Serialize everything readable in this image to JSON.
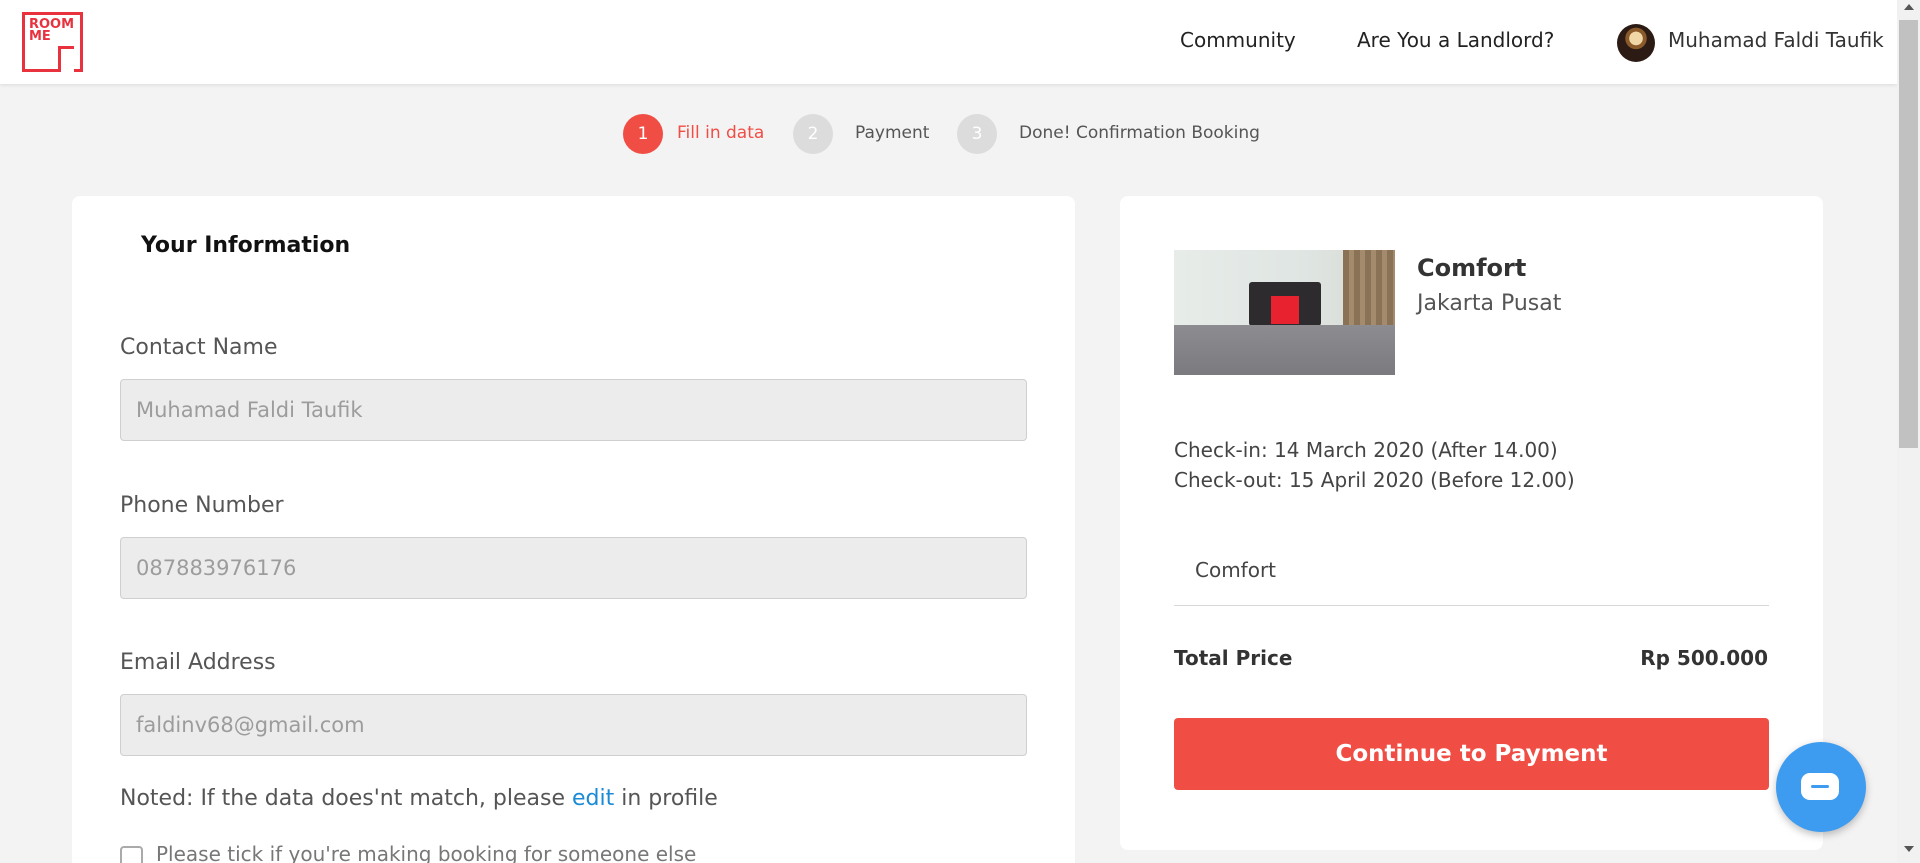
{
  "header": {
    "logo_text": "ROOM ME",
    "nav": {
      "community": "Community",
      "landlord": "Are You a Landlord?",
      "user_name": "Muhamad Faldi Taufik"
    }
  },
  "stepper": {
    "steps": [
      {
        "number": "1",
        "label": "Fill in data",
        "active": true
      },
      {
        "number": "2",
        "label": "Payment",
        "active": false
      },
      {
        "number": "3",
        "label": "Done! Confirmation Booking",
        "active": false
      }
    ],
    "active_color": "#f04e45"
  },
  "form": {
    "title": "Your Information",
    "contact_name": {
      "label": "Contact Name",
      "value": "Muhamad Faldi Taufik"
    },
    "phone": {
      "label": "Phone Number",
      "value": "087883976176"
    },
    "email": {
      "label": "Email Address",
      "value": "faldinv68@gmail.com"
    },
    "note_prefix": "Noted: If the data does'nt match, please ",
    "note_link": "edit",
    "note_suffix": " in profile",
    "tick_label": "Please tick if you're making booking for someone else"
  },
  "summary": {
    "room_name": "Comfort",
    "location": "Jakarta Pusat",
    "checkin": "Check-in: 14 March 2020 (After 14.00)",
    "checkout": "Check-out: 15 April 2020 (Before 12.00)",
    "room_type": "Comfort",
    "total_label": "Total Price",
    "total_value": "Rp 500.000",
    "pay_button": "Continue to Payment"
  },
  "colors": {
    "brand": "#e8333f",
    "button": "#f04e45",
    "link": "#1a8ad6",
    "chat": "#3d9cf0"
  },
  "icons": {
    "chat": "chat-icon"
  }
}
